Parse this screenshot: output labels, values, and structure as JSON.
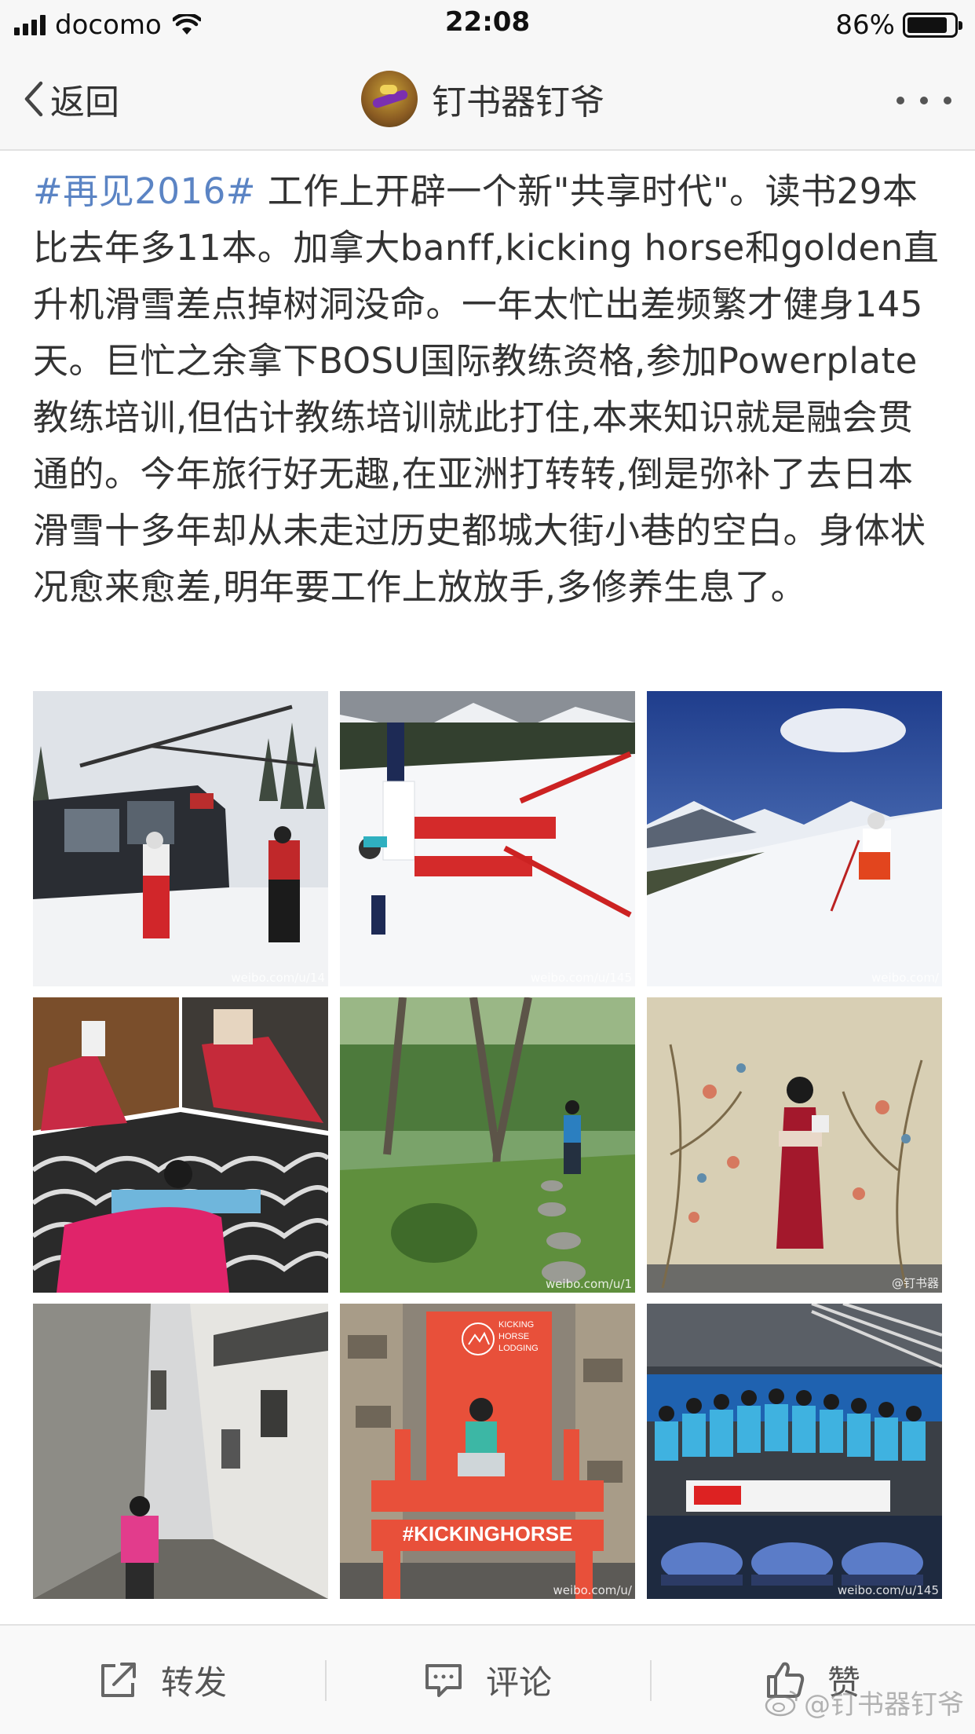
{
  "status_bar": {
    "carrier": "docomo",
    "time": "22:08",
    "battery_percent": "86%",
    "battery_level": 0.86,
    "icons": [
      "signal-icon",
      "wifi-icon",
      "battery-icon"
    ]
  },
  "nav": {
    "back_label": "返回",
    "title": "钉书器钉爷",
    "more_icon": "ellipsis-icon",
    "back_icon": "chevron-left-icon"
  },
  "post": {
    "hashtag": "#再见2016#",
    "body": " 工作上开辟一个新\"共享时代\"。读书29本比去年多11本。加拿大banff,kicking horse和golden直升机滑雪差点掉树洞没命。一年太忙出差频繁才健身145天。巨忙之余拿下BOSU国际教练资格,参加Powerplate教练培训,但估计教练培训就此打住,本来知识就是融会贯通的。今年旅行好无趣,在亚洲打转转,倒是弥补了去日本滑雪十多年却从未走过历史都城大街小巷的空白。身体状况愈来愈差,明年要工作上放放手,多修养生息了。"
  },
  "photos": [
    {
      "subject": "helicopter-skiing",
      "watermark": "weibo.com/u/14"
    },
    {
      "subject": "skier-handstand-snow",
      "watermark": "weibo.com/u/145"
    },
    {
      "subject": "skier-mountain-slope",
      "watermark": "weibo.com/"
    },
    {
      "subject": "hanbok-collage",
      "watermark": ""
    },
    {
      "subject": "garden-path",
      "watermark": "weibo.com/u/1"
    },
    {
      "subject": "kimono-mural",
      "watermark": "@钉书器"
    },
    {
      "subject": "old-alley",
      "watermark": ""
    },
    {
      "subject": "kicking-horse-chair",
      "watermark": "weibo.com/u/"
    },
    {
      "subject": "bosu-training-group",
      "watermark": "weibo.com/u/145"
    }
  ],
  "photo_texts": {
    "chair_sign": "#KICKINGHORSE",
    "chair_logo_line1": "KICKING",
    "chair_logo_line2": "HORSE",
    "chair_logo_line3": "LODGING"
  },
  "toolbar": {
    "repost_label": "转发",
    "comment_label": "评论",
    "like_label": "赞",
    "repost_icon": "share-icon",
    "comment_icon": "comment-icon",
    "like_icon": "thumbs-up-icon"
  },
  "footer_watermark": "@钉书器钉爷",
  "colors": {
    "hashtag": "#5b84c4",
    "text": "#333333",
    "bar_background": "#f7f7f7"
  }
}
